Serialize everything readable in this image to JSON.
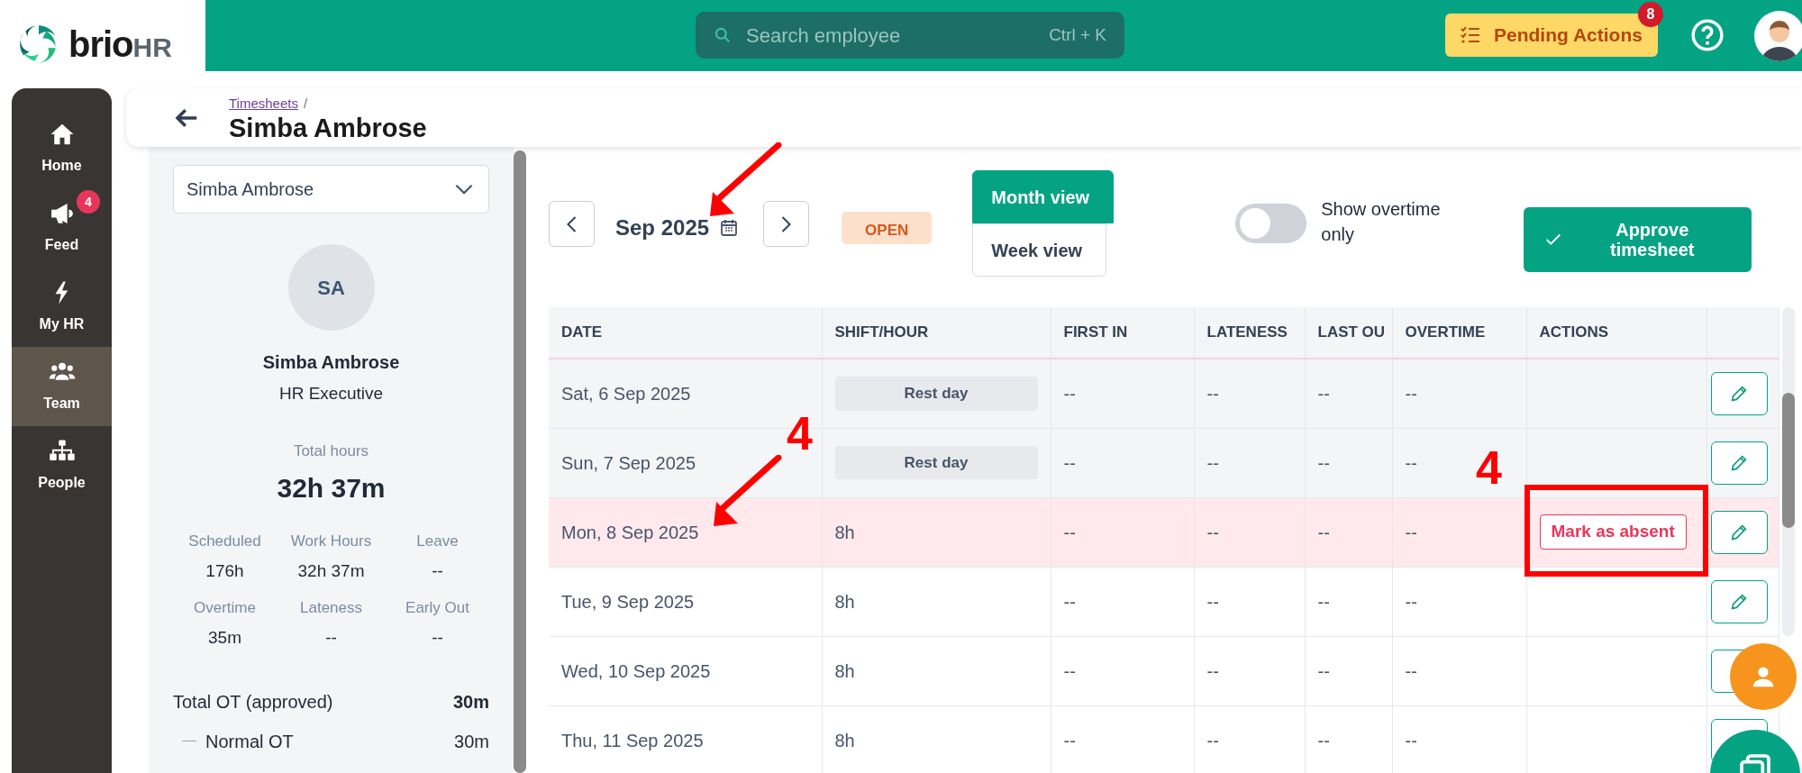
{
  "logo": {
    "text": "brio",
    "suffix": "HR"
  },
  "search": {
    "placeholder": "Search employee",
    "shortcut": "Ctrl + K"
  },
  "pending_actions": {
    "label": "Pending Actions",
    "count": "8"
  },
  "nav": [
    {
      "label": "Home",
      "selected": false
    },
    {
      "label": "Feed",
      "selected": false,
      "badge": "4"
    },
    {
      "label": "My HR",
      "selected": false
    },
    {
      "label": "Team",
      "selected": true
    },
    {
      "label": "People",
      "selected": false
    }
  ],
  "header": {
    "breadcrumb": "Timesheets",
    "separator": "/",
    "title": "Simba Ambrose"
  },
  "employee_panel": {
    "select_value": "Simba Ambrose",
    "initials": "SA",
    "name": "Simba Ambrose",
    "role": "HR Executive",
    "total_label": "Total hours",
    "total_value": "32h 37m",
    "stats": [
      {
        "label": "Scheduled",
        "value": "176h"
      },
      {
        "label": "Work Hours",
        "value": "32h 37m"
      },
      {
        "label": "Leave",
        "value": "--"
      },
      {
        "label": "Overtime",
        "value": "35m"
      },
      {
        "label": "Lateness",
        "value": "--"
      },
      {
        "label": "Early Out",
        "value": "--"
      }
    ],
    "ot": [
      {
        "label": "Total OT (approved)",
        "value": "30m",
        "kind": "total"
      },
      {
        "label": "Normal OT",
        "value": "30m",
        "kind": "sub"
      }
    ]
  },
  "toolbar": {
    "month": "Sep 2025",
    "status": "OPEN",
    "views": [
      {
        "label": "Month view",
        "selected": true
      },
      {
        "label": "Week view",
        "selected": false
      }
    ],
    "overtime_toggle": {
      "label": "Show overtime only",
      "on": false
    },
    "approve": "Approve timesheet"
  },
  "table": {
    "columns": [
      "DATE",
      "SHIFT/HOUR",
      "FIRST IN",
      "LATENESS",
      "LAST OU",
      "OVERTIME",
      "ACTIONS"
    ],
    "rows": [
      {
        "date": "Sat, 6 Sep 2025",
        "shift": "Rest day",
        "kind": "rest",
        "first_in": "--",
        "lateness": "--",
        "last_out": "--",
        "overtime": "--",
        "highlighted": false
      },
      {
        "date": "Sun, 7 Sep 2025",
        "shift": "Rest day",
        "kind": "rest",
        "first_in": "--",
        "lateness": "--",
        "last_out": "--",
        "overtime": "--",
        "highlighted": false
      },
      {
        "date": "Mon, 8 Sep 2025",
        "shift": "8h",
        "kind": "work",
        "first_in": "--",
        "lateness": "--",
        "last_out": "--",
        "overtime": "--",
        "highlighted": true,
        "action": "Mark as absent"
      },
      {
        "date": "Tue, 9 Sep 2025",
        "shift": "8h",
        "kind": "work",
        "first_in": "--",
        "lateness": "--",
        "last_out": "--",
        "overtime": "--",
        "highlighted": false
      },
      {
        "date": "Wed, 10 Sep 2025",
        "shift": "8h",
        "kind": "work",
        "first_in": "--",
        "lateness": "--",
        "last_out": "--",
        "overtime": "--",
        "highlighted": false
      },
      {
        "date": "Thu, 11 Sep 2025",
        "shift": "8h",
        "kind": "work",
        "first_in": "--",
        "lateness": "--",
        "last_out": "--",
        "overtime": "--",
        "highlighted": false
      }
    ]
  },
  "annotations": [
    {
      "kind": "arrow"
    },
    {
      "kind": "number",
      "text": "4"
    },
    {
      "kind": "arrow"
    },
    {
      "kind": "number",
      "text": "4"
    },
    {
      "kind": "box"
    }
  ]
}
